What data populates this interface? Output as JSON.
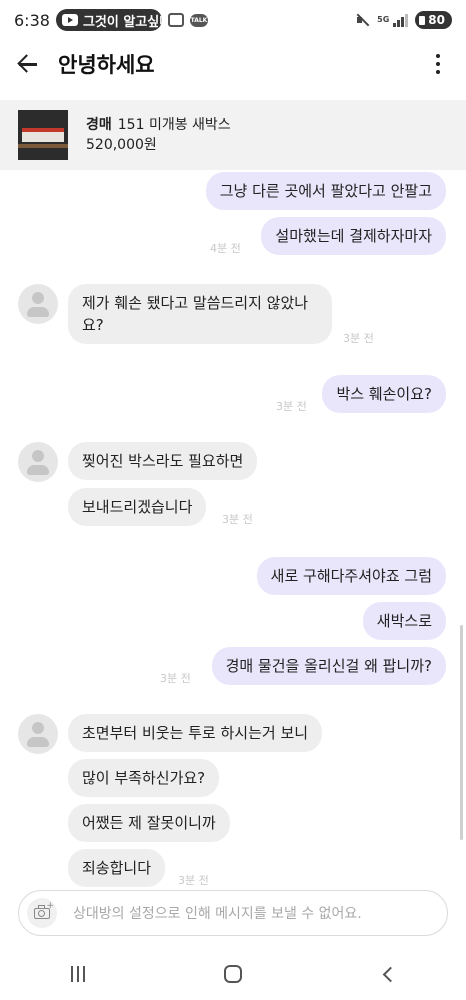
{
  "status_bar": {
    "time": "6:38",
    "youtube_text": "그것이 알고싶다",
    "network": "5G",
    "battery": "80"
  },
  "header": {
    "title": "안녕하세요"
  },
  "product": {
    "tag": "경매",
    "name": "151 미개봉 새박스",
    "price": "520,000원"
  },
  "messages": [
    {
      "side": "out",
      "text": "그냥 다른 곳에서 팔았다고 안팔고",
      "time": ""
    },
    {
      "side": "out",
      "text": "설마했는데 결제하자마자",
      "time": "4분 전"
    },
    {
      "side": "in",
      "text": "제가 훼손 됐다고 말씀드리지 않았나요?",
      "time": "3분 전"
    },
    {
      "side": "out",
      "text": "박스 훼손이요?",
      "time": "3분 전"
    },
    {
      "side": "in",
      "text": "찢어진 박스라도 필요하면",
      "time": ""
    },
    {
      "side": "in",
      "text": "보내드리겠습니다",
      "time": "3분 전"
    },
    {
      "side": "out",
      "text": "새로 구해다주셔야죠 그럼",
      "time": ""
    },
    {
      "side": "out",
      "text": "새박스로",
      "time": ""
    },
    {
      "side": "out",
      "text": "경매 물건을 올리신걸 왜 팝니까?",
      "time": "3분 전"
    },
    {
      "side": "in",
      "text": "초면부터 비웃는 투로 하시는거 보니",
      "time": ""
    },
    {
      "side": "in",
      "text": "많이 부족하신가요?",
      "time": ""
    },
    {
      "side": "in",
      "text": "어쨌든 제 잘못이니까",
      "time": ""
    },
    {
      "side": "in",
      "text": "죄송합니다",
      "time": "3분 전"
    }
  ],
  "input": {
    "placeholder": "상대방의 설정으로 인해 메시지를 보낼 수 없어요."
  },
  "colors": {
    "outgoing_bubble": "#e9e6fb",
    "incoming_bubble": "#eeeeee",
    "product_bg": "#f2f2f2"
  }
}
